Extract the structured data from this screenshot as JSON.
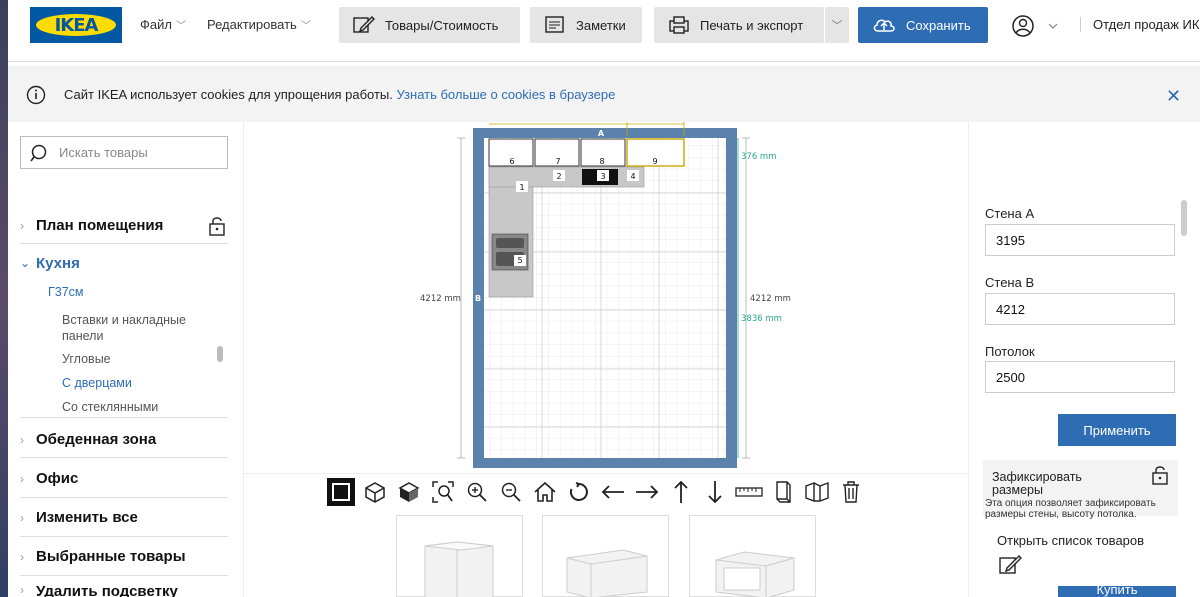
{
  "header": {
    "logo_text": "IKEA",
    "menu_file": "Файл",
    "menu_edit": "Редактировать",
    "btn_products": "Товары/Стоимость",
    "btn_notes": "Заметки",
    "btn_print": "Печать и экспорт",
    "btn_save": "Сохранить",
    "department": "Отдел продаж ИКЕ"
  },
  "cookie": {
    "text": "Сайт IKEA использует cookies для упрощения работы.",
    "link": "Узнать больше о cookies в браузере"
  },
  "sidebar": {
    "search_placeholder": "Искать товары",
    "sections": {
      "room_plan": "План помещения",
      "kitchen": "Кухня",
      "dining": "Обеденная зона",
      "office": "Офис",
      "change_all": "Изменить все",
      "selected": "Выбранные товары",
      "remove_highlight": "Удалить подсветку"
    },
    "kitchen_sub": {
      "group": "Г37см",
      "items": [
        "Вставки и накладные панели",
        "Угловые",
        "С дверцами",
        "Со стеклянными"
      ]
    }
  },
  "plan": {
    "wall_a_label": "A",
    "wall_b_label": "B",
    "dim_left": "4212 mm",
    "dim_right": "4212 mm",
    "dim_inner": "3836 mm",
    "dim_top_right": "376 mm",
    "items": [
      "6",
      "7",
      "8",
      "9",
      "1",
      "2",
      "3",
      "4",
      "5"
    ]
  },
  "right": {
    "wall_a_label": "Стена А",
    "wall_a_value": "3195",
    "wall_b_label": "Стена В",
    "wall_b_value": "4212",
    "ceiling_label": "Потолок",
    "ceiling_value": "2500",
    "apply": "Применить",
    "lock_title": "Зафиксировать размеры",
    "lock_desc": "Эта опция позволяет зафиксировать размеры стены, высоту потолка.",
    "open_list": "Открыть список товаров",
    "buy": "Купить"
  },
  "colors": {
    "accent": "#2e6db4",
    "wall": "#5b82ad",
    "brand_blue": "#0058a3",
    "brand_yellow": "#ffdb00"
  }
}
